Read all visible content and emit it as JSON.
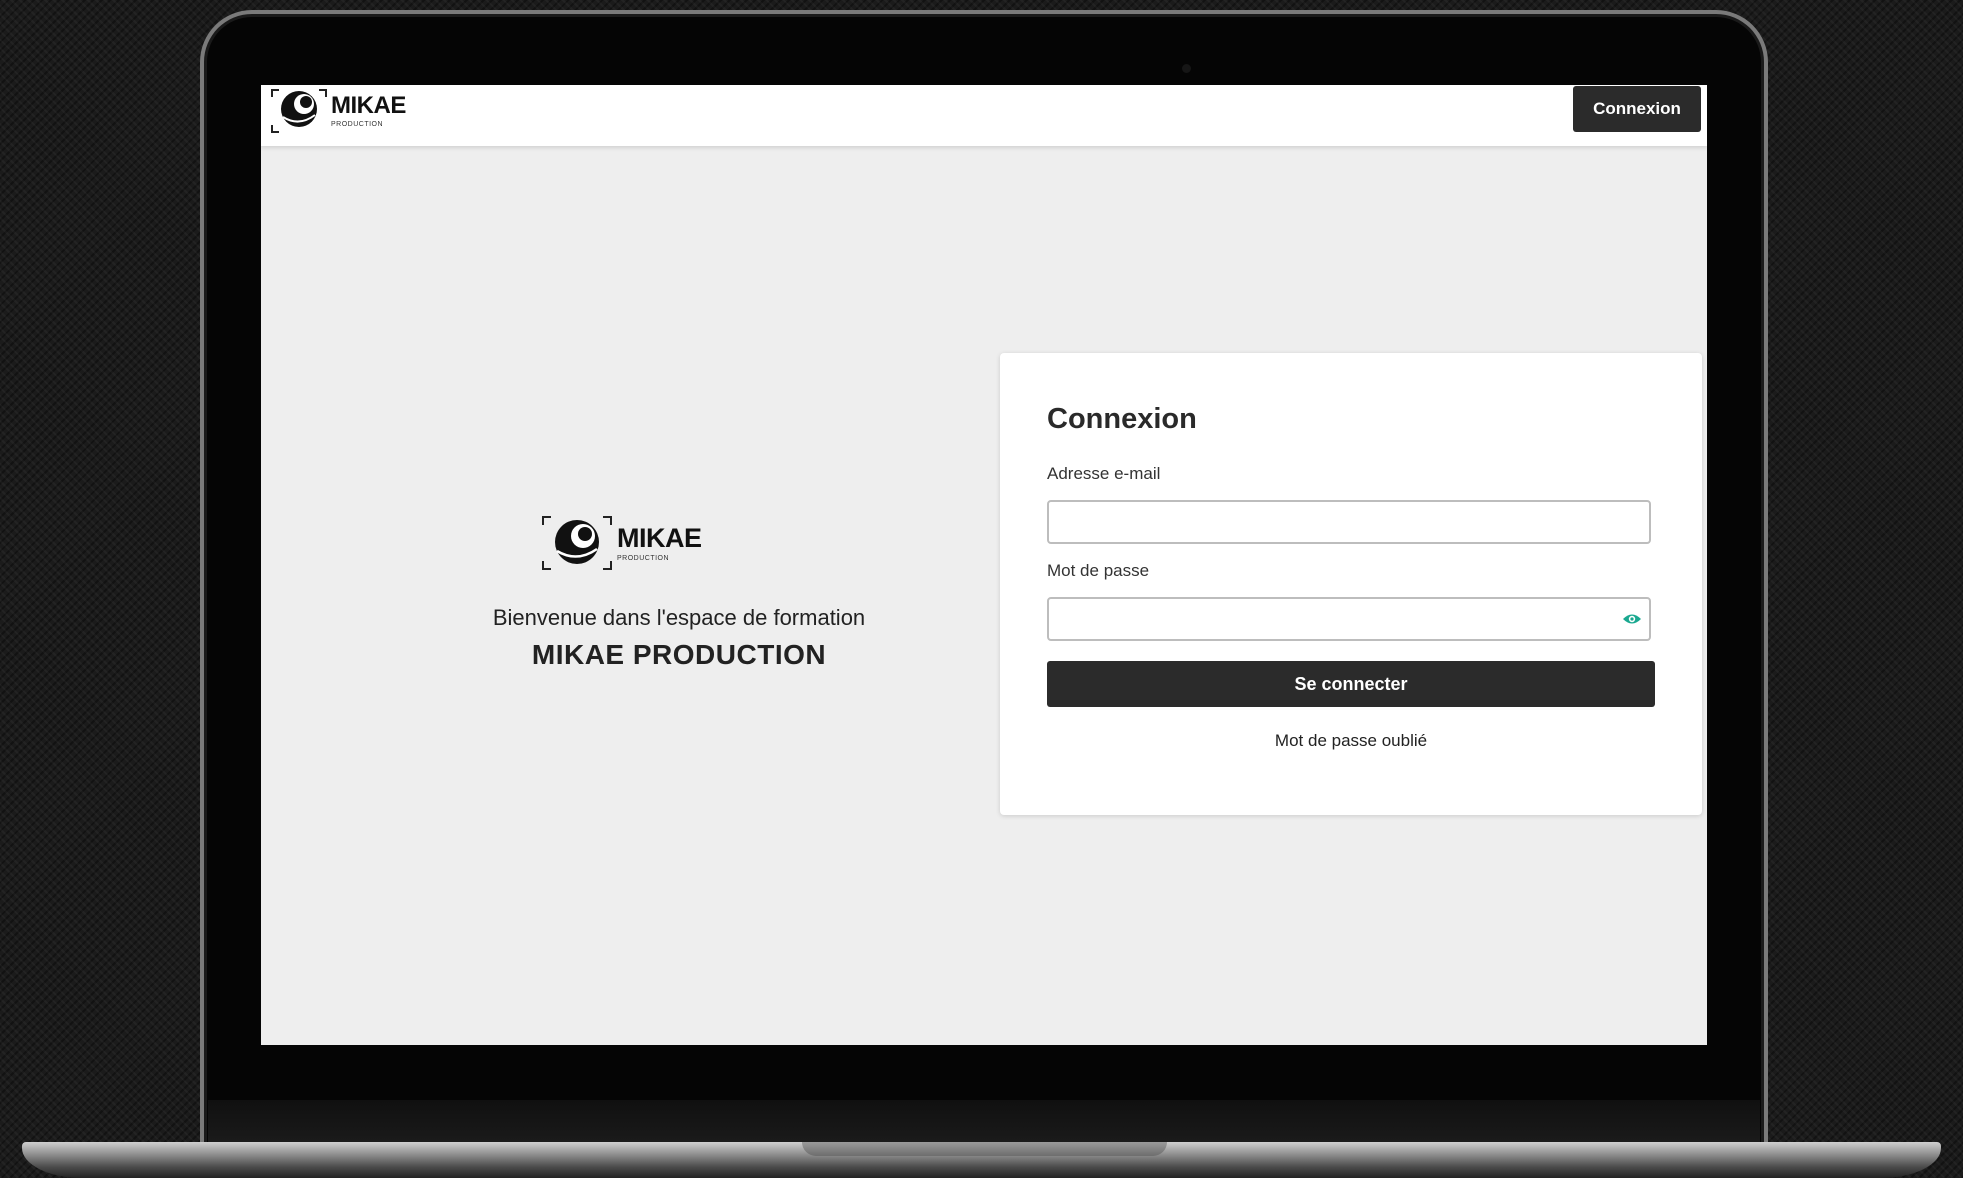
{
  "header": {
    "logo": {
      "wordmark": "MIKAE",
      "tagline": "PRODUCTION"
    },
    "login_button": "Connexion"
  },
  "welcome": {
    "logo": {
      "wordmark": "MIKAE",
      "tagline": "PRODUCTION"
    },
    "line1": "Bienvenue dans l'espace de formation",
    "line2": "MIKAE PRODUCTION"
  },
  "login_form": {
    "title": "Connexion",
    "email": {
      "label": "Adresse e-mail",
      "value": "",
      "placeholder": ""
    },
    "password": {
      "label": "Mot de passe",
      "value": "",
      "placeholder": ""
    },
    "submit_label": "Se connecter",
    "forgot_label": "Mot de passe oublié"
  },
  "colors": {
    "page_bg": "#eeeeee",
    "button_bg": "#2b2b2b",
    "eye_icon": "#1aa890"
  },
  "icons": [
    "eye-icon",
    "mikae-logo-icon"
  ]
}
